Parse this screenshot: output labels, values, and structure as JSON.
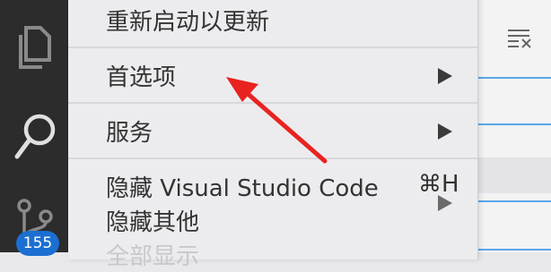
{
  "menu": {
    "items": [
      {
        "label": "重新启动以更新",
        "has_submenu": false
      },
      {
        "label": "首选项",
        "has_submenu": true
      },
      {
        "label": "服务",
        "has_submenu": true
      },
      {
        "label": "隐藏 Visual Studio Code",
        "shortcut": "⌘H",
        "has_submenu": false
      },
      {
        "label": "隐藏其他",
        "has_submenu": false
      },
      {
        "label": "全部显示",
        "has_submenu": false
      }
    ]
  },
  "activity_bar": {
    "icons": [
      "files-icon",
      "search-icon",
      "source-control-icon"
    ],
    "scm_badge": "155"
  },
  "colors": {
    "annotation_arrow": "#e8231f",
    "badge": "#1b6fd1",
    "activity_bar": "#2c2c2c",
    "menu_bg": "#ececef"
  }
}
